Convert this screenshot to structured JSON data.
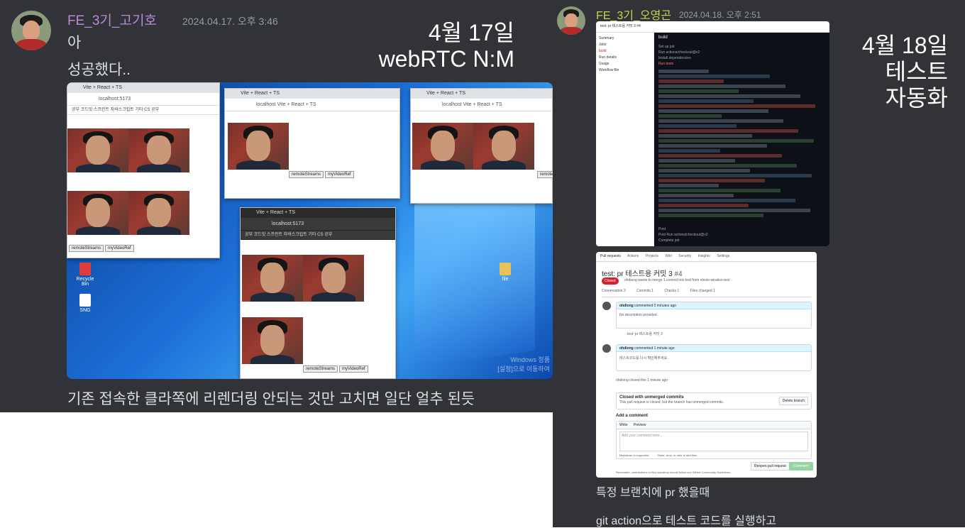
{
  "left_message": {
    "username": "FE_3기_고기호",
    "timestamp": "2024.04.17. 오후 3:46",
    "lines": [
      "아",
      "성공했다.."
    ],
    "overlay": [
      "4월 17일",
      "webRTC N:M"
    ],
    "caption": "기존 접속한 클라쪽에 리렌더링 안되는 것만 고치면 일단 얼추 된듯",
    "screenshot": {
      "windows": [
        {
          "tab": "Vite + React + TS",
          "address": "localhost:5173",
          "bookmarks": "공부   코드잇 스프린트   자바스크립트 기타   CS 공부",
          "buttons": [
            "remoteStreams",
            "myVideoRef"
          ]
        },
        {
          "tab": "Vite + React + TS",
          "address": "localhost  Vite + React + TS",
          "buttons": [
            "remoteStreams",
            "myVideoRef"
          ]
        },
        {
          "tab": "Vite + React + TS",
          "address": "localhost  Vite + React + TS",
          "buttons": [
            "remoteStreams"
          ]
        },
        {
          "tab": "Vite + React + TS",
          "address": "localhost:5173",
          "bookmarks": "공부   코드잇 스프린트   자바스크립트 기타   CS 공부",
          "buttons": [
            "remoteStreams",
            "myVideoRef"
          ]
        }
      ],
      "desktop_icons": [
        "Recycle Bin",
        "SNG",
        "file"
      ],
      "watermark": [
        "Windows 정품",
        "[설정]으로 이동하여"
      ]
    }
  },
  "right_message": {
    "username": "FE_3기_오영곤",
    "timestamp": "2024.04.18. 오후 2:51",
    "overlay": [
      "4월 18일",
      "테스트",
      "자동화"
    ],
    "lines": [
      "특정 브랜치에 pr 했을때",
      "git action으로 테스트 코드를 실행하고"
    ],
    "actions_screenshot": {
      "title": "test: pr 테스트용 커밋 3 #4",
      "sidebar": [
        "Summary",
        "Jobs",
        "build",
        "Run details",
        "Usage",
        "Workflow file"
      ],
      "job": "build",
      "steps": [
        "Set up job",
        "Run actions/checkout@v2",
        "Install dependencies",
        "Run tests",
        "Post",
        "Post Run actions/checkout@v2",
        "Complete job"
      ]
    },
    "pr_screenshot": {
      "nav": [
        "Pull requests",
        "Actions",
        "Projects",
        "Wiki",
        "Security",
        "Insights",
        "Settings"
      ],
      "title": "test: pr 테스트용 커밋 3",
      "number": "#4",
      "state": "Closed",
      "subtitle": "ohdiong wants to merge 1 commit into test from elesio-wiration-test",
      "tabs": [
        "Conversation 3",
        "Commits 1",
        "Checks 1",
        "Files changed 1"
      ],
      "comments": [
        {
          "author": "ohdiong",
          "meta": "commented 2 minutes ago",
          "body": "No description provided."
        },
        {
          "author": "ohdiong",
          "meta": "commented 1 minute ago",
          "body": "테스트코드를 다시 확인해주세요."
        }
      ],
      "commit": "test: pr 테스트용 커밋 3",
      "closed_event": "ohdiong closed this 1 minute ago",
      "unmerged_title": "Closed with unmerged commits",
      "unmerged_body": "This pull request is closed, but the branch has unmerged commits.",
      "delete_branch": "Delete branch",
      "add_comment": "Add a comment",
      "write_tab": "Write",
      "preview_tab": "Preview",
      "placeholder": "Add your comment here...",
      "markdown_note": "Markdown is supported",
      "attach_note": "Paste, drop, or click to add files",
      "reopen": "Reopen pull request",
      "comment_btn": "Comment",
      "footer": "Remember, contributions to this repository should follow our GitHub Community Guidelines."
    }
  }
}
